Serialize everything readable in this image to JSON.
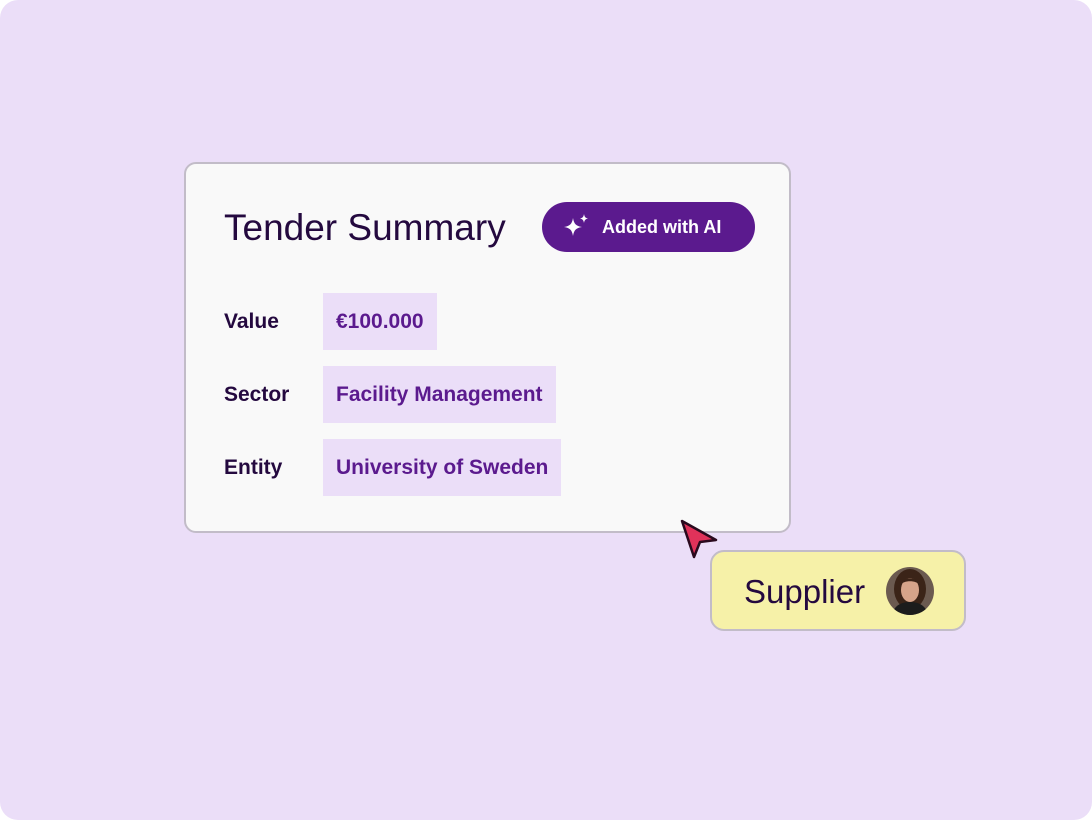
{
  "card": {
    "title": "Tender Summary",
    "ai_badge": {
      "label": "Added with AI",
      "icon": "sparkles-icon"
    },
    "fields": [
      {
        "label": "Value",
        "value": "€100.000"
      },
      {
        "label": "Sector",
        "value": "Facility Management"
      },
      {
        "label": "Entity",
        "value": "University of Sweden"
      }
    ]
  },
  "supplier_tag": {
    "label": "Supplier",
    "avatar": "user-avatar"
  },
  "cursor": {
    "icon": "pointer-cursor-icon",
    "color": "#e0325a"
  },
  "colors": {
    "background": "#ebdef8",
    "card_background": "#f9f9f9",
    "accent": "#5b1a8e",
    "text_dark": "#24093f",
    "value_chip_background": "#ebdef8",
    "supplier_background": "#f6f1a8"
  }
}
